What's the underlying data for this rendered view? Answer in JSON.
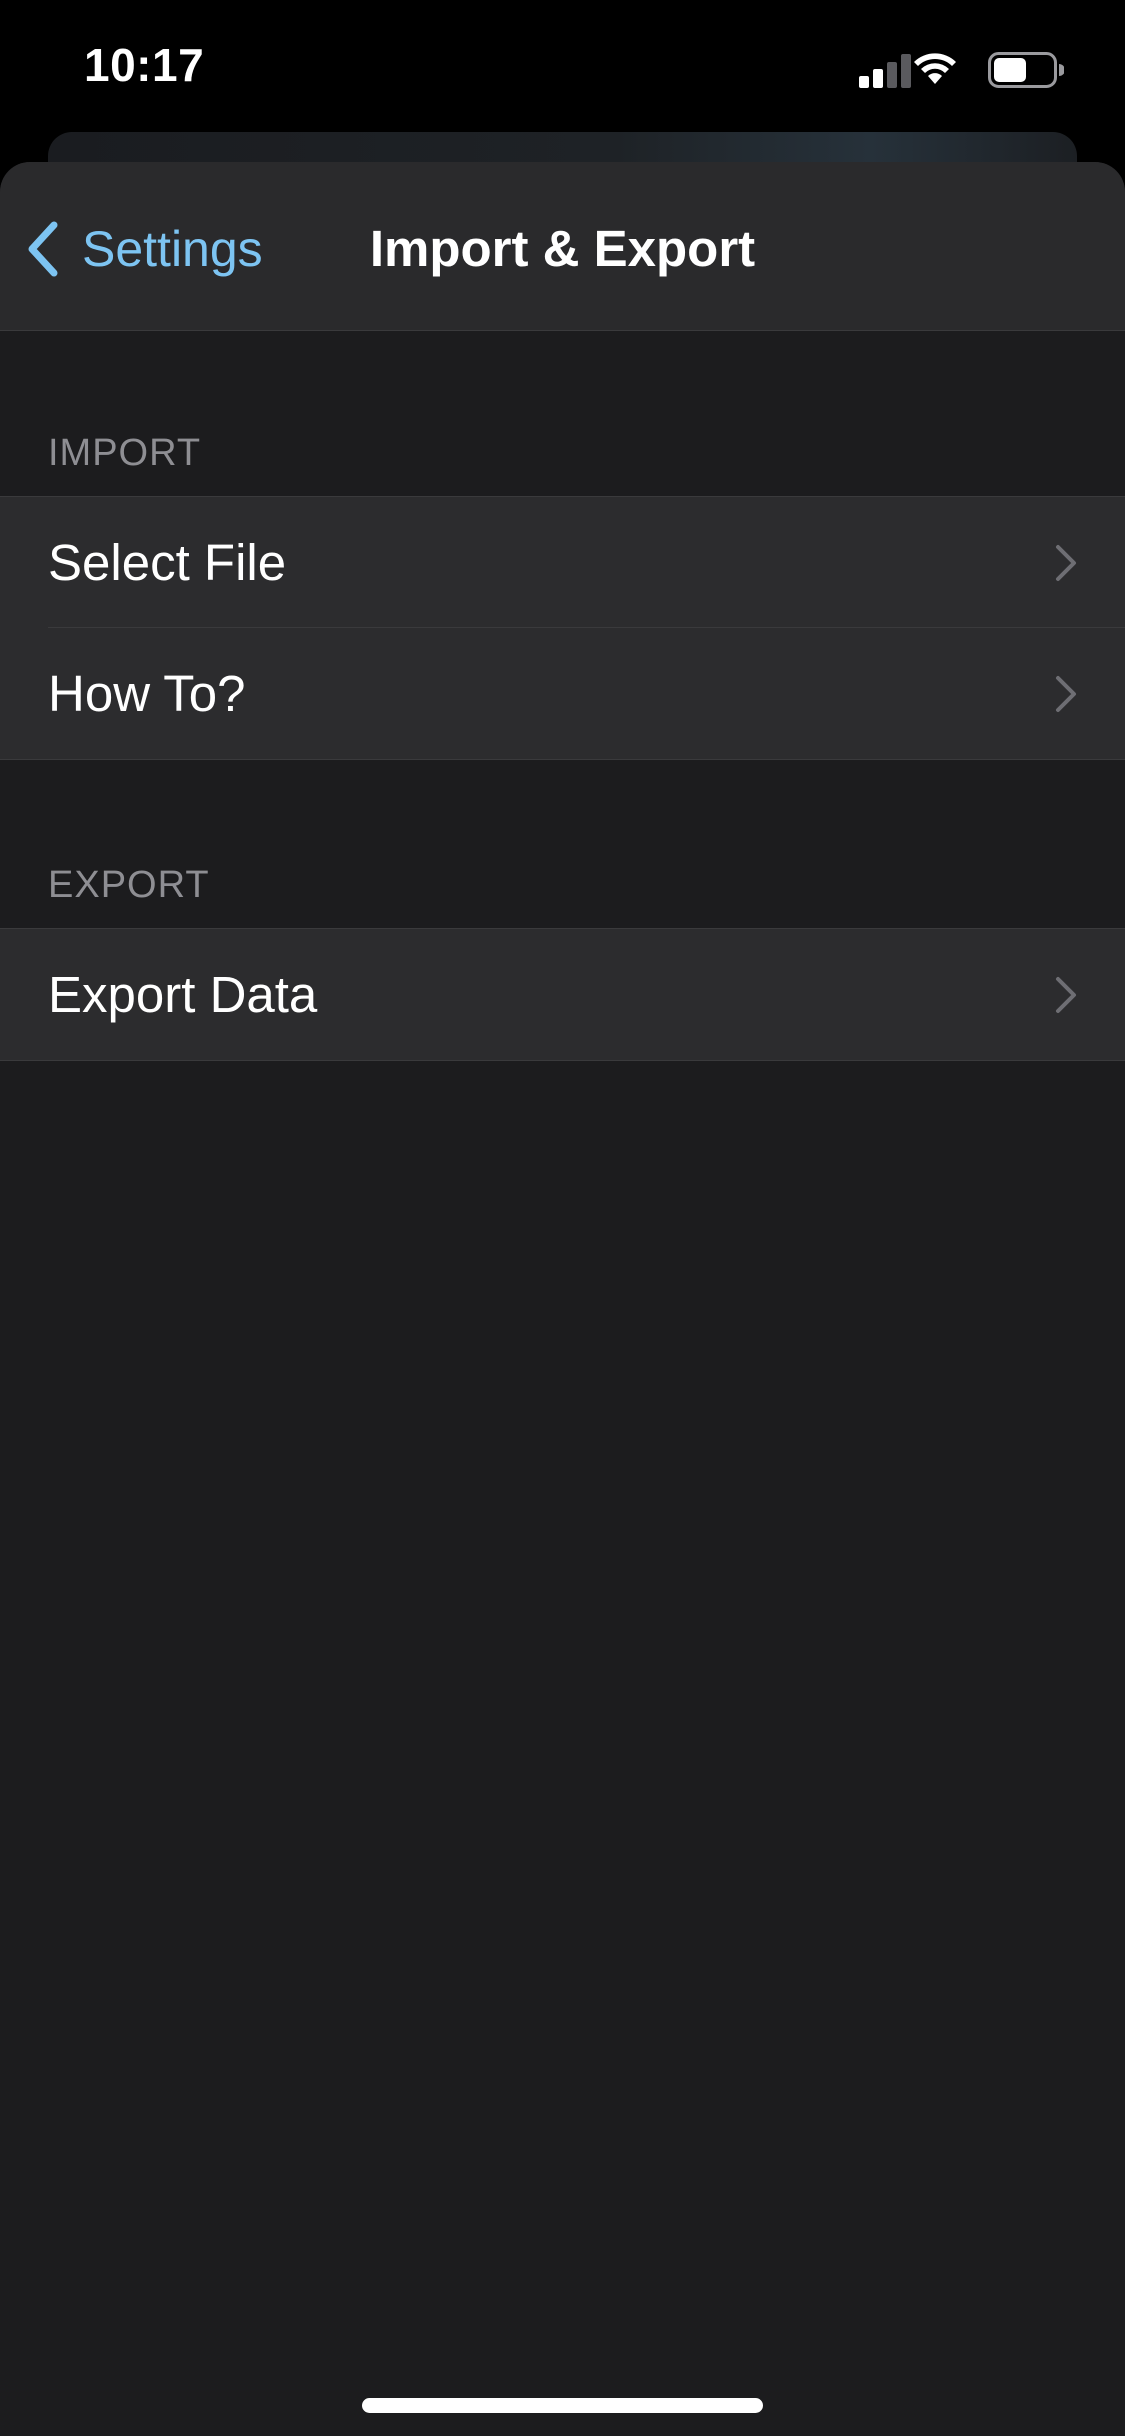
{
  "status_bar": {
    "time": "10:17",
    "icons": [
      "signal-icon",
      "wifi-icon",
      "battery-icon"
    ],
    "battery_level": 0.55
  },
  "nav": {
    "back_label": "Settings",
    "title": "Import & Export",
    "back_icon": "chevron-left-icon"
  },
  "sections": {
    "import": {
      "header": "IMPORT",
      "items": [
        {
          "label": "Select File",
          "icon": "chevron-right-icon"
        },
        {
          "label": "How To?",
          "icon": "chevron-right-icon"
        }
      ]
    },
    "export": {
      "header": "EXPORT",
      "items": [
        {
          "label": "Export Data",
          "icon": "chevron-right-icon"
        }
      ]
    }
  },
  "colors": {
    "accent": "#7dc4f2",
    "background": "#1c1c1e",
    "cell": "#2c2c2e",
    "nav_bar": "#2a2a2c",
    "secondary_text": "#8e8e93"
  }
}
